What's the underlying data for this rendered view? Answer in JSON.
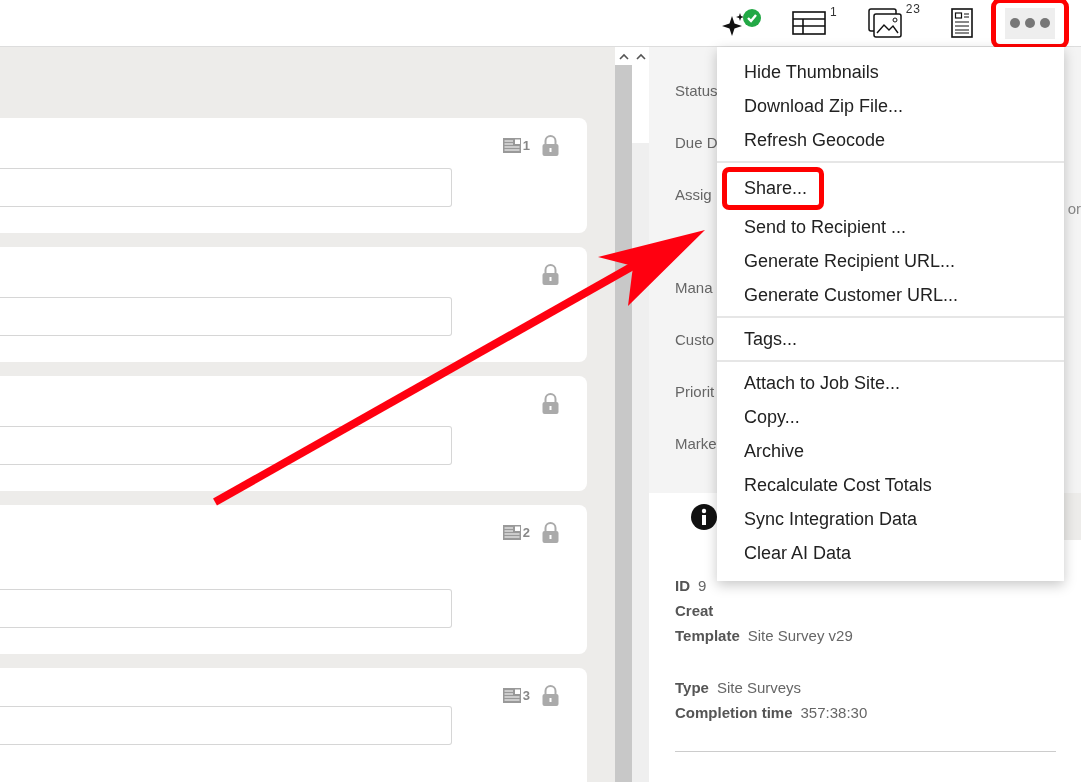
{
  "toolbar": [
    {
      "kind": "sparkle-check",
      "highlighted": false
    },
    {
      "kind": "table",
      "count": "1",
      "highlighted": false
    },
    {
      "kind": "images",
      "count": "23",
      "highlighted": false
    },
    {
      "kind": "document",
      "highlighted": false
    },
    {
      "kind": "more",
      "highlighted": true
    }
  ],
  "cards": [
    {
      "attachments": "1",
      "locked": true
    },
    {
      "locked": true
    },
    {
      "locked": true
    },
    {
      "attachments": "2",
      "locked": true
    },
    {
      "attachments": "3",
      "locked": true
    }
  ],
  "details_panel": {
    "fields": [
      {
        "label": "Status"
      },
      {
        "label": "Due D"
      },
      {
        "label": "Assig",
        "value": "or"
      },
      {
        "label": "Mana"
      },
      {
        "label": "Custo"
      },
      {
        "label": "Priorit"
      },
      {
        "label": "Marke"
      }
    ]
  },
  "properties": [
    [
      {
        "label": "ID",
        "value": "9"
      },
      {
        "label": "Creat"
      },
      {
        "label": "Template",
        "value": "Site Survey v29"
      }
    ],
    [
      {
        "label": "Type",
        "value": "Site Surveys"
      },
      {
        "label": "Completion time",
        "value": "357:38:30"
      }
    ]
  ],
  "menu": {
    "groups": [
      [
        {
          "label": "Hide Thumbnails",
          "highlighted": false
        },
        {
          "label": "Download Zip File...",
          "highlighted": false
        },
        {
          "label": "Refresh Geocode",
          "highlighted": false
        }
      ],
      [
        {
          "label": "Share...",
          "highlighted": true
        },
        {
          "label": "Send to Recipient ...",
          "highlighted": false
        },
        {
          "label": "Generate Recipient URL...",
          "highlighted": false
        },
        {
          "label": "Generate Customer URL...",
          "highlighted": false
        }
      ],
      [
        {
          "label": "Tags...",
          "highlighted": false
        }
      ],
      [
        {
          "label": "Attach to Job Site...",
          "highlighted": false
        },
        {
          "label": "Copy...",
          "highlighted": false
        },
        {
          "label": "Archive",
          "highlighted": false
        },
        {
          "label": "Recalculate Cost Totals",
          "highlighted": false
        },
        {
          "label": "Sync Integration Data",
          "highlighted": false
        },
        {
          "label": "Clear AI Data",
          "highlighted": false
        }
      ]
    ]
  }
}
